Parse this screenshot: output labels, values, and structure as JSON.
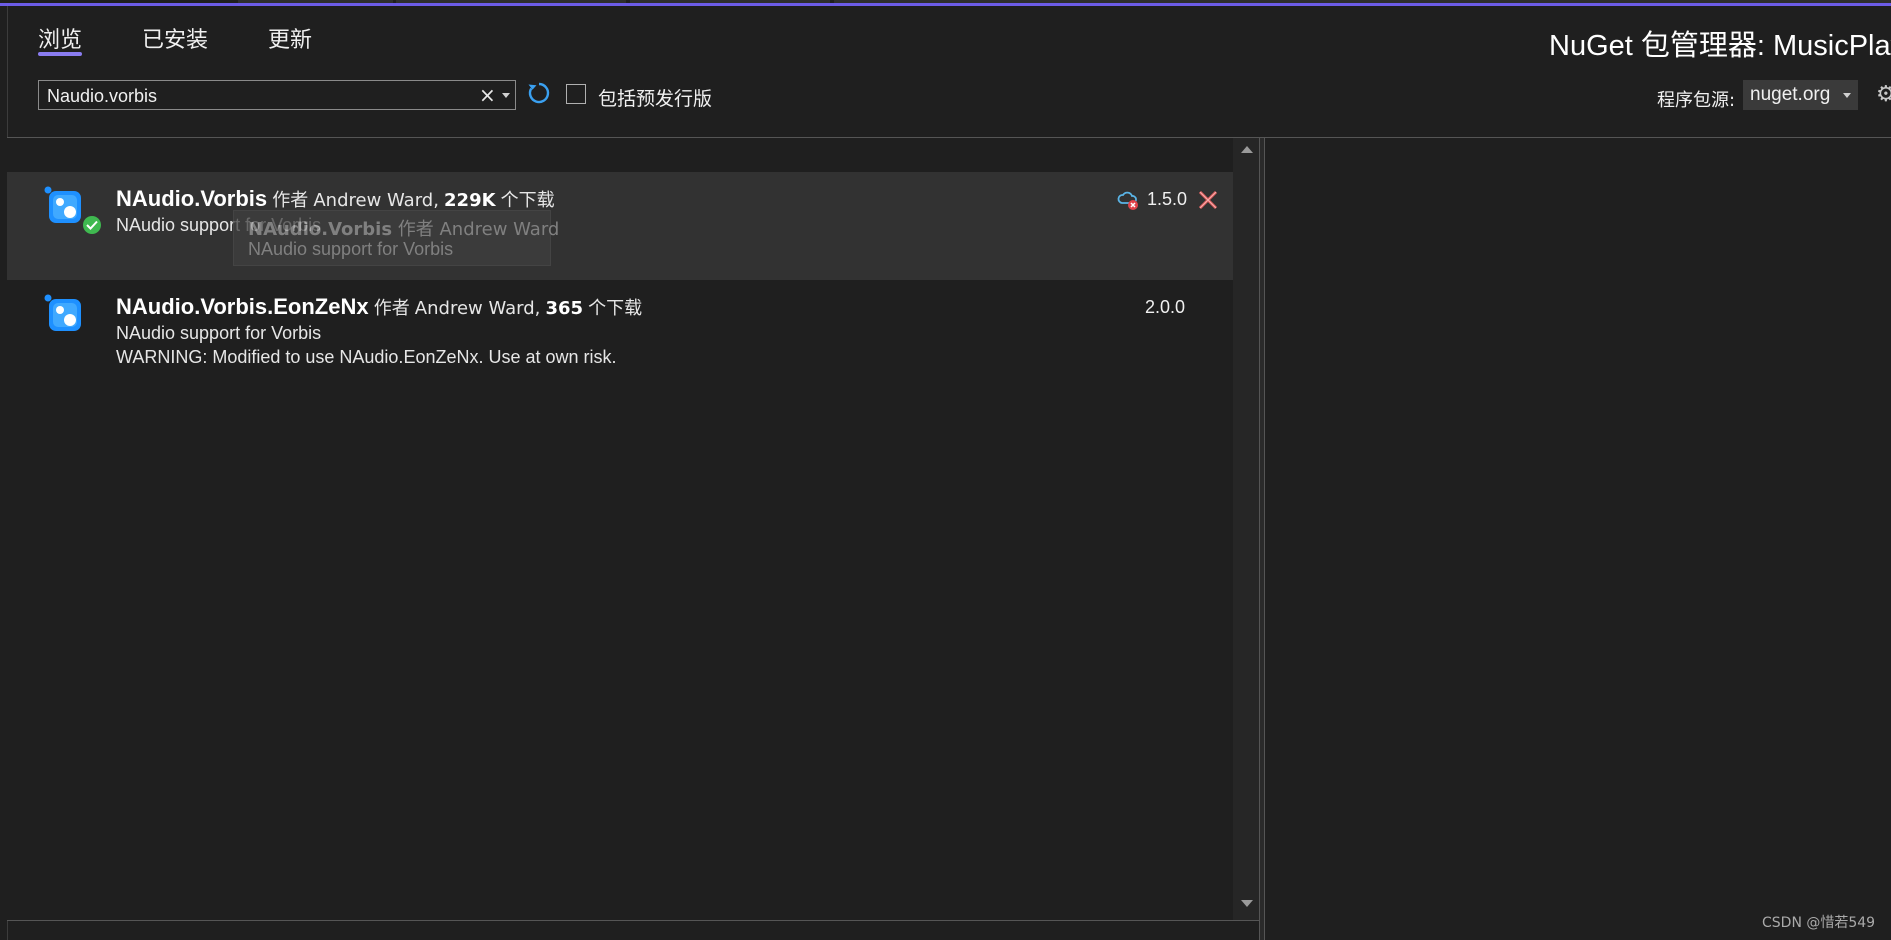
{
  "tabs": [
    {
      "label": "浏览",
      "active": true
    },
    {
      "label": "已安装",
      "active": false
    },
    {
      "label": "更新",
      "active": false
    }
  ],
  "title": "NuGet 包管理器: MusicPlay",
  "search": {
    "value": "Naudio.vorbis",
    "clear": "×"
  },
  "prerelease": {
    "label": "包括预发行版",
    "checked": false
  },
  "source": {
    "label": "程序包源:",
    "selected": "nuget.org"
  },
  "packages": [
    {
      "name": "NAudio.Vorbis",
      "author_prefix": "作者",
      "author": "Andrew Ward,",
      "downloads": "229K",
      "downloads_suffix": "个下载",
      "description": "NAudio support for Vorbis",
      "version": "1.5.0",
      "installed": true,
      "selected": true
    },
    {
      "name": "NAudio.Vorbis.EonZeNx",
      "author_prefix": "作者",
      "author": "Andrew Ward,",
      "downloads": "365",
      "downloads_suffix": "个下载",
      "description": "NAudio support for Vorbis",
      "description2": "WARNING: Modified to use NAudio.EonZeNx. Use at own risk.",
      "version": "2.0.0",
      "installed": false,
      "selected": false
    }
  ],
  "tooltip": {
    "line1_name": "NAudio.Vorbis",
    "line1_rest": "作者 Andrew Ward",
    "line2": "NAudio support for Vorbis"
  },
  "watermark": "CSDN @惜若549",
  "colors": {
    "accent": "#6c5ce7",
    "installed_badge": "#3fb950",
    "uninstall_x": "#e05a5a",
    "cloud_error": "#e0434b",
    "package_icon": "#1e90ff"
  }
}
